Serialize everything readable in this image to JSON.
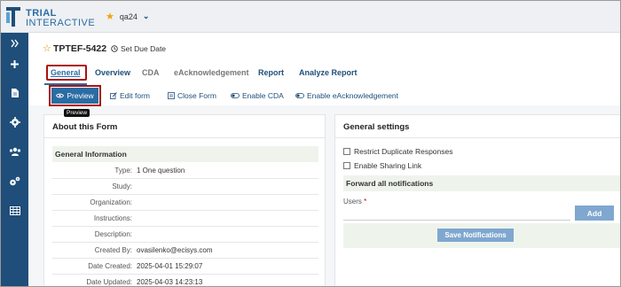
{
  "brand": {
    "line1": "TRIAL",
    "line2": "INTERACTIVE"
  },
  "site": {
    "name": "qa24"
  },
  "record": {
    "title": "TPTEF-5422",
    "due_label": "Set Due Date"
  },
  "tabs": [
    {
      "label": "General"
    },
    {
      "label": "Overview"
    },
    {
      "label": "CDA"
    },
    {
      "label": "eAcknowledgement"
    },
    {
      "label": "Report"
    },
    {
      "label": "Analyze Report"
    }
  ],
  "tooltip": "Preview",
  "toolbar": {
    "preview": "Preview",
    "edit": "Edit form",
    "close": "Close Form",
    "enable_cda": "Enable CDA",
    "enable_eack": "Enable eAcknowledgement"
  },
  "about": {
    "title": "About this Form",
    "section": "General Information",
    "rows": [
      {
        "label": "Type:",
        "value": "1 One question"
      },
      {
        "label": "Study:",
        "value": ""
      },
      {
        "label": "Organization:",
        "value": ""
      },
      {
        "label": "Instructions:",
        "value": ""
      },
      {
        "label": "Description:",
        "value": ""
      },
      {
        "label": "Created By:",
        "value": "ovasilenko@ecisys.com"
      },
      {
        "label": "Date Created:",
        "value": "2025-04-01 15:29:07"
      },
      {
        "label": "Date Updated:",
        "value": "2025-04-03 14:23:13"
      }
    ]
  },
  "settings": {
    "title": "General settings",
    "restrict": "Restrict Duplicate Responses",
    "sharing": "Enable Sharing Link",
    "forward": "Forward all notifications",
    "users_label": "Users",
    "required_mark": "*",
    "add": "Add",
    "save": "Save Notifications"
  },
  "colors": {
    "sidebar": "#1e4e79",
    "accent": "#2b6ca3",
    "highlight": "#a11111",
    "section_bg": "#eef4ec"
  }
}
